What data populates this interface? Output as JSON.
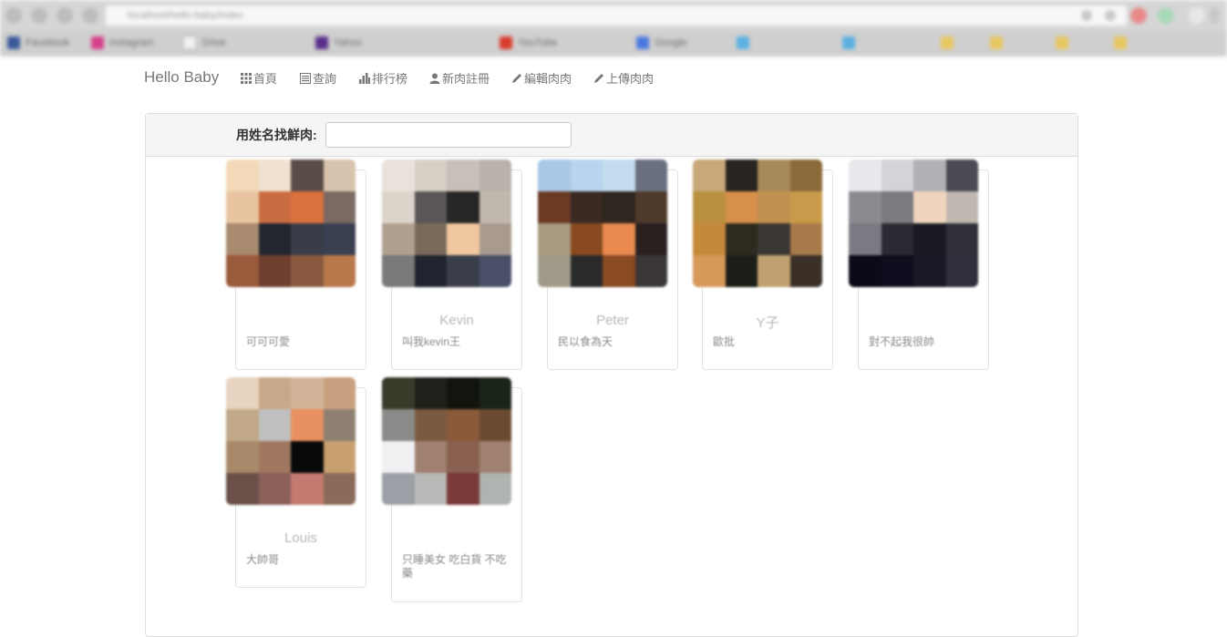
{
  "browser": {
    "url": "localhost/hello-baby/index",
    "bookmarks": [
      "Facebook",
      "Instagram",
      "Drive",
      "Yahoo",
      "YouTube",
      "Google"
    ]
  },
  "navbar": {
    "brand": "Hello Baby",
    "items": [
      {
        "label": "首頁",
        "icon": "grid-icon"
      },
      {
        "label": "查詢",
        "icon": "list-icon"
      },
      {
        "label": "排行榜",
        "icon": "bar-chart-icon"
      },
      {
        "label": "新肉註冊",
        "icon": "user-icon"
      },
      {
        "label": "編輯肉肉",
        "icon": "pencil-icon"
      },
      {
        "label": "上傳肉肉",
        "icon": "pencil-icon"
      }
    ]
  },
  "search": {
    "label": "用姓名找鮮肉:",
    "value": "",
    "placeholder": ""
  },
  "cards": [
    {
      "name": "",
      "desc": "可可可愛",
      "photo": [
        "#f4d9b8",
        "#f0e2d0",
        "#5a4c48",
        "#d8c4ae",
        "#e8c4a0",
        "#c96c42",
        "#d9703e",
        "#7a6a62",
        "#a88a6e",
        "#23262f",
        "#3a3d48",
        "#3a3f52",
        "#9a5a3c",
        "#6e3e2e",
        "#8a5a40",
        "#b8784c"
      ]
    },
    {
      "name": "Kevin",
      "desc": "叫我kevin王",
      "photo": [
        "#e8e2da",
        "#d8d0c6",
        "#c8c0b8",
        "#b8b2aa",
        "#dcd4ca",
        "#5a5656",
        "#262626",
        "#c0b8ae",
        "#b0a090",
        "#7a6a5a",
        "#f0c8a0",
        "#a89a8e",
        "#7a7a7a",
        "#20242e",
        "#3a3e4a",
        "#4a5068"
      ]
    },
    {
      "name": "Peter",
      "desc": "民以食為天",
      "photo": [
        "#a8c8e8",
        "#b8d4ee",
        "#c4dcf0",
        "#6a7080",
        "#6a3a22",
        "#3a2a22",
        "#2e2620",
        "#4e3a2a",
        "#a89a80",
        "#8a4a20",
        "#e88a50",
        "#2a2020",
        "#a09a88",
        "#2a2a2a",
        "#8a4a22",
        "#3a3636"
      ]
    },
    {
      "name": "Y子",
      "desc": "歐批",
      "photo": [
        "#c8a878",
        "#2a2420",
        "#a88a5a",
        "#8a6a3a",
        "#b89040",
        "#d6904a",
        "#c0904e",
        "#c89a4a",
        "#c48a3a",
        "#2e2a20",
        "#3a3632",
        "#a87a4a",
        "#d8985a",
        "#1e1e18",
        "#c0a070",
        "#3a3028"
      ]
    },
    {
      "name": "",
      "desc": "對不起我很帥",
      "photo": [
        "#e8e8ec",
        "#d4d4d8",
        "#b0b0b6",
        "#4a4a52",
        "#8a8a90",
        "#7a7a80",
        "#f0d4c0",
        "#c0b8b0",
        "#7a7a82",
        "#2a2a32",
        "#1a1a22",
        "#30303a",
        "#0a0a18",
        "#0e0e1e",
        "#1a1a26",
        "#30303c"
      ]
    },
    {
      "name": "Louis",
      "desc": "大帥哥",
      "photo": [
        "#e8d4c0",
        "#c8a888",
        "#d4b498",
        "#c8a080",
        "#c0a888",
        "#c0c0c0",
        "#e89060",
        "#8e8070",
        "#a88a6a",
        "#a07860",
        "#0a0a0a",
        "#c8a070",
        "#6a5048",
        "#8a6058",
        "#c47a70",
        "#8a6a5a"
      ]
    },
    {
      "name": "",
      "desc": "只睡美女 吃白貨 不吃藥",
      "photo": [
        "#3a3a2a",
        "#1e221a",
        "#12140e",
        "#1a2418",
        "#8a8a88",
        "#7a5a40",
        "#8a5a3a",
        "#6a4a30",
        "#f0f0f2",
        "#a08070",
        "#8a6050",
        "#a08070",
        "#9aa0a6",
        "#b8bab8",
        "#7a3a3a",
        "#b0b4b0"
      ]
    }
  ]
}
